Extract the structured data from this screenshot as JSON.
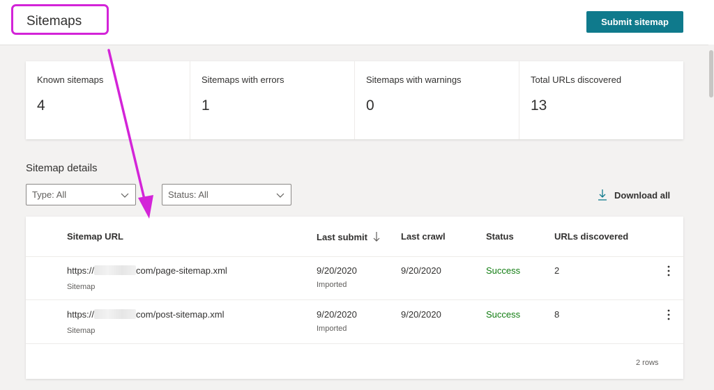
{
  "header": {
    "title": "Sitemaps",
    "submit_label": "Submit sitemap"
  },
  "stats": [
    {
      "label": "Known sitemaps",
      "value": "4"
    },
    {
      "label": "Sitemaps with errors",
      "value": "1"
    },
    {
      "label": "Sitemaps with warnings",
      "value": "0"
    },
    {
      "label": "Total URLs discovered",
      "value": "13"
    }
  ],
  "details": {
    "title": "Sitemap details",
    "type_filter": "Type: All",
    "status_filter": "Status: All",
    "download_label": "Download all"
  },
  "table": {
    "columns": {
      "url": "Sitemap URL",
      "last_submit": "Last submit",
      "last_crawl": "Last crawl",
      "status": "Status",
      "urls": "URLs discovered"
    },
    "rows": [
      {
        "url_prefix": "https://",
        "url_suffix": "com/page-sitemap.xml",
        "type": "Sitemap",
        "last_submit": "9/20/2020",
        "submit_note": "Imported",
        "last_crawl": "9/20/2020",
        "status": "Success",
        "urls": "2"
      },
      {
        "url_prefix": "https://",
        "url_suffix": "com/post-sitemap.xml",
        "type": "Sitemap",
        "last_submit": "9/20/2020",
        "submit_note": "Imported",
        "last_crawl": "9/20/2020",
        "status": "Success",
        "urls": "8"
      }
    ],
    "row_count": "2 rows"
  },
  "colors": {
    "accent": "#0f7a8c",
    "success": "#107c10",
    "annotation": "#d324d8"
  }
}
